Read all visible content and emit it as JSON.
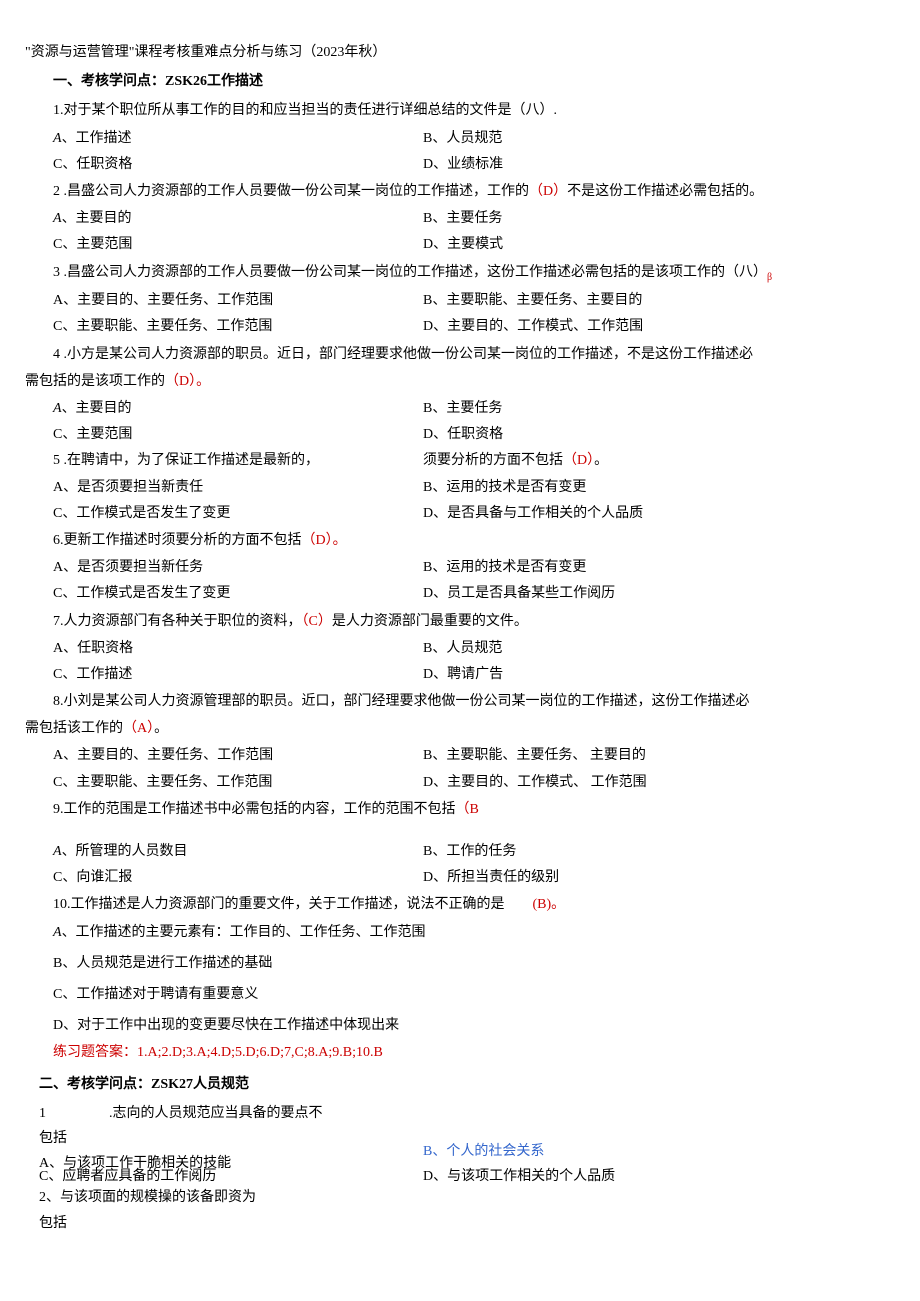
{
  "top_title": "\"资源与运营管理\"课程考核重难点分析与练习（2023年秋）",
  "section1_header": "一、考核学问点：ZSK26工作描述",
  "q1": {
    "stem": "1.对于某个职位所从事工作的目的和应当担当的责任进行详细总结的文件是（八）.",
    "a": "、工作描述",
    "b": "B、人员规范",
    "c": "C、任职资格",
    "d": "D、业绩标准"
  },
  "q2": {
    "stem_prefix": "2 .昌盛公司人力资源部的工作人员要做一份公司某一岗位的工作描述，工作的",
    "stem_ans": "（D）",
    "stem_suffix": "不是这份工作描述必需包括的。",
    "a": "、主要目的",
    "b": "B、主要任务",
    "c": "C、主要范围",
    "d": "D、主要模式"
  },
  "q3": {
    "stem": "3 .昌盛公司人力资源部的工作人员要做一份公司某一岗位的工作描述，这份工作描述必需包括的是该项工作的（八）",
    "sub": "β",
    "a": "A、主要目的、主要任务、工作范围",
    "b": "B、主要职能、主要任务、主要目的",
    "c": "C、主要职能、主要任务、工作范围",
    "d": "D、主要目的、工作模式、工作范围"
  },
  "q4": {
    "stem_line1": "4 .小方是某公司人力资源部的职员。近日，部门经理要求他做一份公司某一岗位的工作描述，不是这份工作描述必",
    "stem_line2a": "需包括的是该项工作的",
    "stem_line2b": "（D）。",
    "a": "、主要目的",
    "b": "B、主要任务",
    "c": "C、主要范围",
    "d": "D、任职资格"
  },
  "q5": {
    "stem_left": "5 .在聘请中，为了保证工作描述是最新的，",
    "stem_right_a": "须要分析的方面不包括",
    "stem_right_b": "（D）",
    "stem_right_c": "。",
    "a": "A、是否须要担当新责任",
    "b": "B、运用的技术是否有变更",
    "c": "C、工作模式是否发生了变更",
    "d": "D、是否具备与工作相关的个人品质"
  },
  "q6": {
    "stem_a": "6.更新工作描述时须要分析的方面不包括",
    "stem_b": "（D）。",
    "a": "A、是否须要担当新任务",
    "b": "B、运用的技术是否有变更",
    "c": "C、工作模式是否发生了变更",
    "d": "D、员工是否具备某些工作阅历"
  },
  "q7": {
    "stem_a": "7.人力资源部门有各种关于职位的资料，",
    "stem_b": "（C）",
    "stem_c": "是人力资源部门最重要的文件。",
    "a": "A、任职资格",
    "b": "B、人员规范",
    "c": "C、工作描述",
    "d": "D、聘请广告"
  },
  "q8": {
    "stem_line1": "8.小刘是某公司人力资源管理部的职员。近口，部门经理要求他做一份公司某一岗位的工作描述，这份工作描述必",
    "stem_line2a": "需包括该工作的",
    "stem_line2b": "（A）",
    "stem_line2c": "。",
    "a": "A、主要目的、主要任务、工作范围",
    "b1": "B、主要职能、主要任务、",
    "b2": "主要目的",
    "c": "C、主要职能、主要任务、工作范围",
    "d1": "D、主要目的、工作模式、",
    "d2": "工作范围"
  },
  "q9": {
    "stem_a": "9.工作的范围是工作描述书中必需包括的内容，工作的范围不包括",
    "stem_b": "（B",
    "a": "、所管理的人员数目",
    "b": "B、工作的任务",
    "c": "C、向谁汇报",
    "d": "D、所担当责任的级别"
  },
  "q10": {
    "stem_a": "10.工作描述是人力资源部门的重要文件，关于工作描述，说法不正确的是",
    "stem_b": "(B)。",
    "a": "、工作描述的主要元素有：工作目的、工作任务、工作范围",
    "b": "B、人员规范是进行工作描述的基础",
    "c": "C、工作描述对于聘请有重要意义",
    "d": "D、对于工作中出现的变更要尽快在工作描述中体现出来"
  },
  "answers1": "练习题答案：1.A;2.D;3.A;4.D;5.D;6.D;7,C;8.A;9.B;10.B",
  "section2_header": "二、考核学问点：ZSK27人员规范",
  "s2q1": {
    "num": "1",
    "stem": ".志向的人员规范应当具备的要点不",
    "cont": "包括",
    "a": "A、与该项工作干脆相关的技能",
    "b": "B、个人的社会关系",
    "c": "C、应聘者应具备的工作阅历",
    "d": "D、与该项工作相关的个人品质"
  },
  "s2q2": {
    "line": "2、与该项面的规模操的该备即资为",
    "cont": "包括"
  }
}
